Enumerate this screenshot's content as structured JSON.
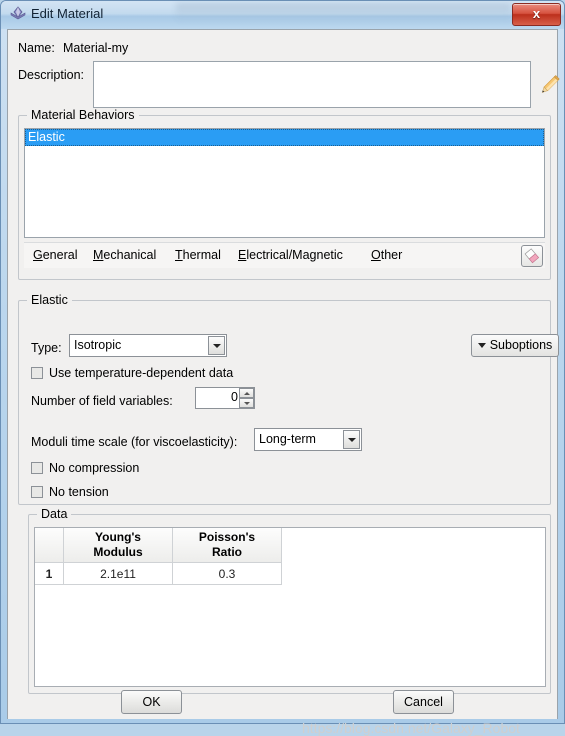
{
  "window": {
    "title": "Edit Material",
    "icon": "abaqus-diamond-icon",
    "close_label": "x",
    "accent_selection_color": "#2a9df4",
    "close_button_color": "#bc2f1c"
  },
  "name_row": {
    "label": "Name:",
    "value": "Material-my"
  },
  "description_row": {
    "label": "Description:",
    "value": "",
    "placeholder": "",
    "edit_icon": "pencil-icon"
  },
  "behaviors": {
    "group_title": "Material Behaviors",
    "items": [
      {
        "label": "Elastic",
        "selected": true
      }
    ],
    "menu": [
      {
        "label": "General",
        "mnemonic": "G"
      },
      {
        "label": "Mechanical",
        "mnemonic": "M"
      },
      {
        "label": "Thermal",
        "mnemonic": "T"
      },
      {
        "label": "Electrical/Magnetic",
        "mnemonic": "E"
      },
      {
        "label": "Other",
        "mnemonic": "O"
      }
    ],
    "delete_icon": "eraser-icon"
  },
  "elastic": {
    "group_title": "Elastic",
    "type_label": "Type:",
    "type_value": "Isotropic",
    "suboptions_label": "Suboptions",
    "temperature_dependent": {
      "label": "Use temperature-dependent data",
      "checked": false
    },
    "field_variables": {
      "label": "Number of field variables:",
      "value": "0"
    },
    "moduli_time_scale": {
      "label": "Moduli time scale (for viscoelasticity):",
      "value": "Long-term"
    },
    "no_compression": {
      "label": "No compression",
      "checked": false
    },
    "no_tension": {
      "label": "No tension",
      "checked": false
    }
  },
  "data_section": {
    "group_title": "Data",
    "columns": [
      {
        "line1": "Young's",
        "line2": "Modulus"
      },
      {
        "line1": "Poisson's",
        "line2": "Ratio"
      }
    ],
    "rows": [
      {
        "number": "1",
        "cells": [
          {
            "value": "2.1e11",
            "selected": false
          },
          {
            "value": "0.3",
            "selected": true
          }
        ]
      }
    ]
  },
  "footer": {
    "ok_label": "OK",
    "cancel_label": "Cancel"
  },
  "watermark": {
    "text": "https://blog.csdn.net/Galaxy_Robot"
  }
}
